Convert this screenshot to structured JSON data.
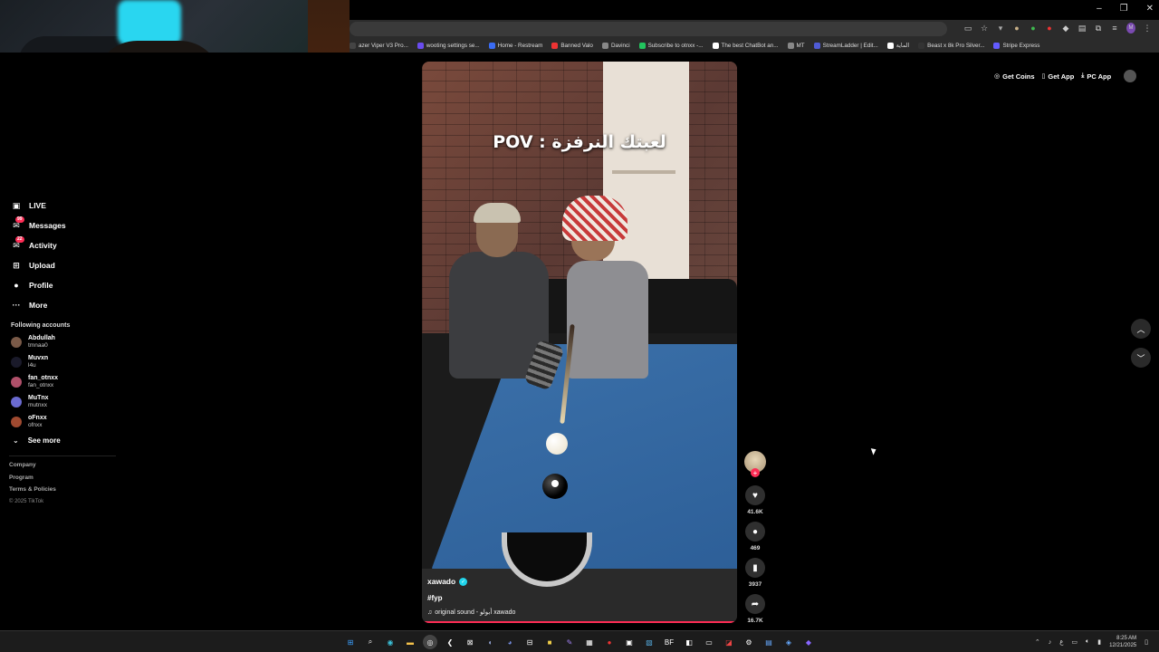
{
  "window": {
    "minimize": "–",
    "maximize": "❐",
    "close": "✕"
  },
  "bookmarks": [
    {
      "label": "azer Viper V3 Pro...",
      "color": "#444"
    },
    {
      "label": "wooting settings se...",
      "color": "#6a4cf0"
    },
    {
      "label": "Home - Restream",
      "color": "#3a6cf5"
    },
    {
      "label": "Banned Valo",
      "color": "#e33"
    },
    {
      "label": "Davinci",
      "color": "#888"
    },
    {
      "label": "Subscribe to otnxx -...",
      "color": "#22c55e"
    },
    {
      "label": "The best ChatBot an...",
      "color": "#fff"
    },
    {
      "label": "MT",
      "color": "#888"
    },
    {
      "label": "StreamLadder | Edit...",
      "color": "#4f5bd5"
    },
    {
      "label": "الماية",
      "color": "#fff"
    },
    {
      "label": "Beast x 8k Pro Silver...",
      "color": "#333"
    },
    {
      "label": "Stripe Express",
      "color": "#635bff"
    }
  ],
  "sidebar": {
    "nav": [
      {
        "label": "LIVE",
        "icon": "live-icon",
        "glyph": "▣",
        "badge": ""
      },
      {
        "label": "Messages",
        "icon": "messages-icon",
        "glyph": "✉",
        "badge": "99"
      },
      {
        "label": "Activity",
        "icon": "activity-icon",
        "glyph": "✉",
        "badge": "22"
      },
      {
        "label": "Upload",
        "icon": "upload-icon",
        "glyph": "⊞",
        "badge": ""
      },
      {
        "label": "Profile",
        "icon": "profile-icon",
        "glyph": "●",
        "badge": ""
      },
      {
        "label": "More",
        "icon": "more-icon",
        "glyph": "···",
        "badge": ""
      }
    ],
    "following_title": "Following accounts",
    "accounts": [
      {
        "name": "Abdullah",
        "handle": "tmnaa0",
        "color": "#7a5a48"
      },
      {
        "name": "Muvxn",
        "handle": "l4u",
        "color": "#1a1a2a"
      },
      {
        "name": "fan_otnxx",
        "handle": "fan_otnxx",
        "color": "#b0506a"
      },
      {
        "name": "MuTnx",
        "handle": "mutnxx",
        "color": "#6a6ad0"
      },
      {
        "name": "oFnxx",
        "handle": "ofnxx",
        "color": "#a04a30"
      }
    ],
    "see_more": "See more",
    "footer": [
      "Company",
      "Program",
      "Terms & Policies"
    ],
    "copyright": "© 2025 TikTok"
  },
  "video": {
    "caption": "POV : لعبتك النرفزة",
    "username": "xawado",
    "hashtag": "#fyp",
    "sound": "original sound - أبولو xawado"
  },
  "actions": {
    "likes": "41.6K",
    "comments": "469",
    "saves": "3937",
    "shares": "16.7K"
  },
  "topbar": {
    "get_coins": "Get Coins",
    "get_app": "Get App",
    "pc_app": "PC App"
  },
  "taskbar": {
    "time": "8:25 AM",
    "date": "12/21/2025",
    "lang": "ع"
  }
}
